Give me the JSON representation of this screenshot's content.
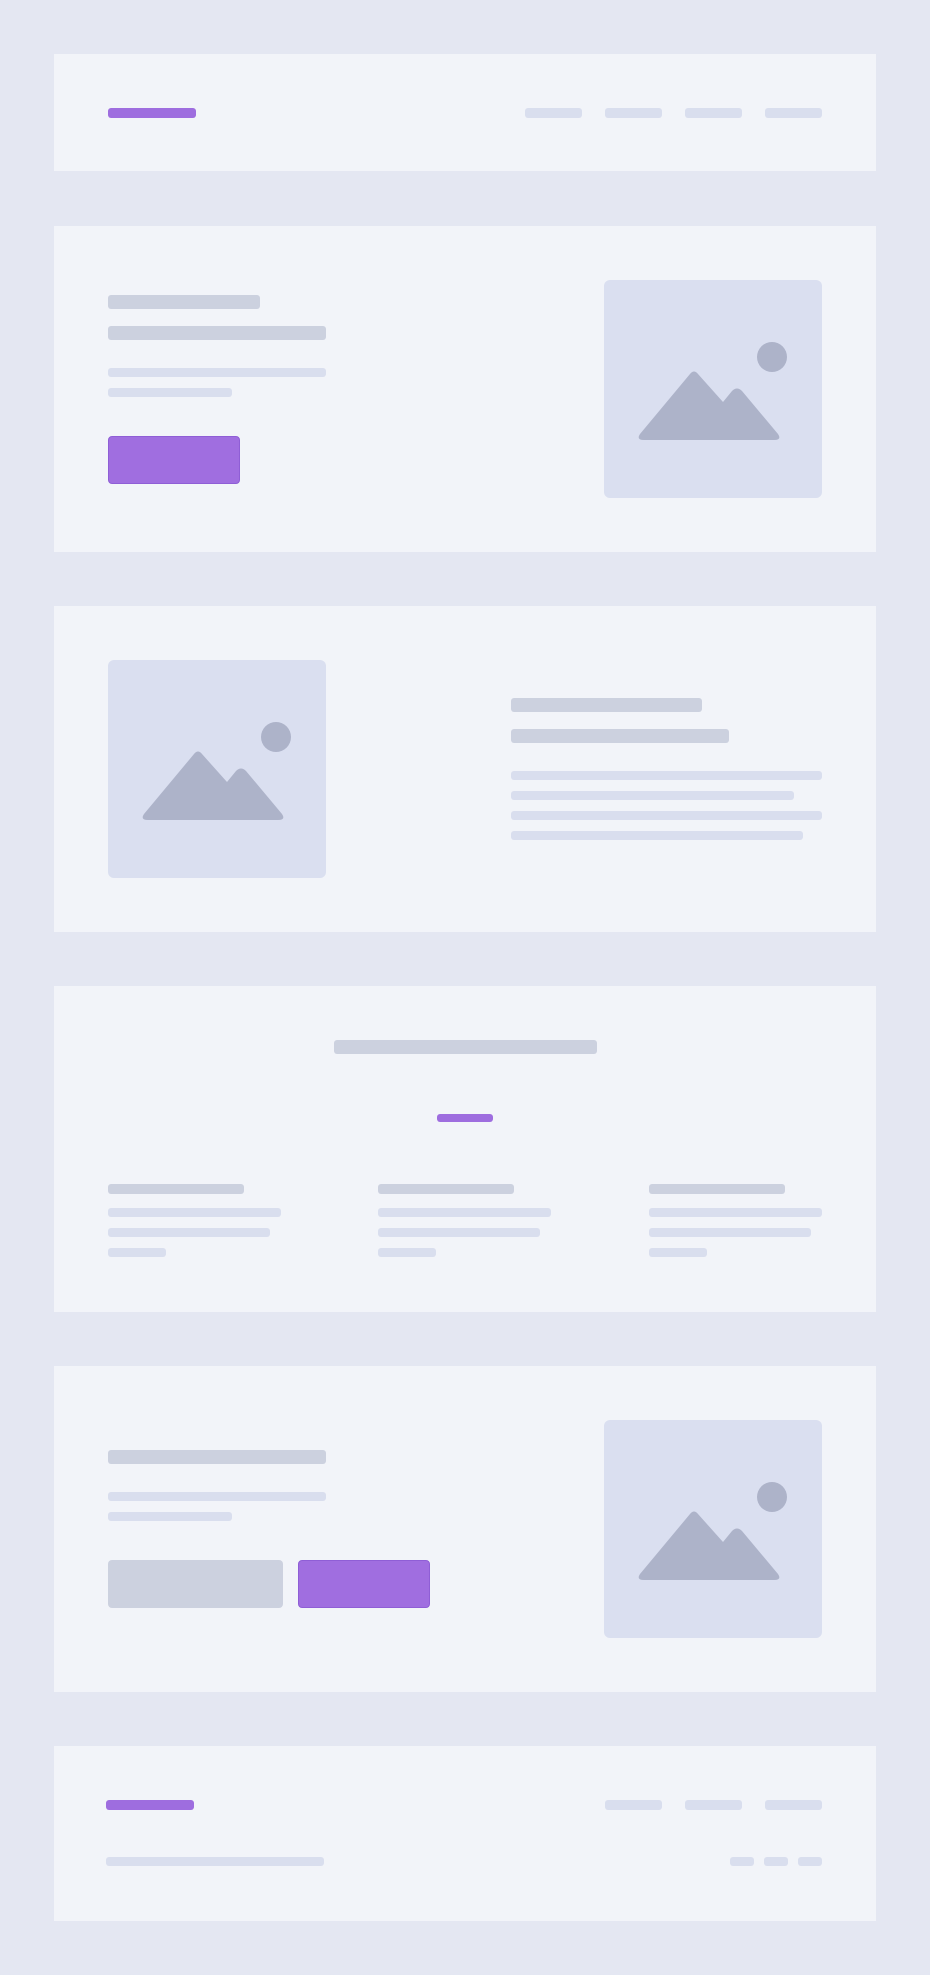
{
  "theme": {
    "background": "#e4e7f2",
    "card": "#f2f4f9",
    "accent": "#9e6ddf",
    "skeleton_dark": "#ccd1df",
    "skeleton_light": "#d9deee",
    "placeholder_bg": "#dadff0",
    "placeholder_icon": "#adb3c9"
  },
  "header": {
    "nav_items": [
      "",
      "",
      "",
      ""
    ]
  },
  "hero": {
    "image_icon": "image-placeholder-icon"
  },
  "feature_split": {
    "image_icon": "image-placeholder-icon"
  },
  "features_grid": {
    "columns": [
      "",
      "",
      ""
    ]
  },
  "cta": {
    "image_icon": "image-placeholder-icon"
  },
  "footer": {
    "nav_items": [
      "",
      "",
      ""
    ],
    "social_items": [
      "",
      "",
      ""
    ]
  }
}
